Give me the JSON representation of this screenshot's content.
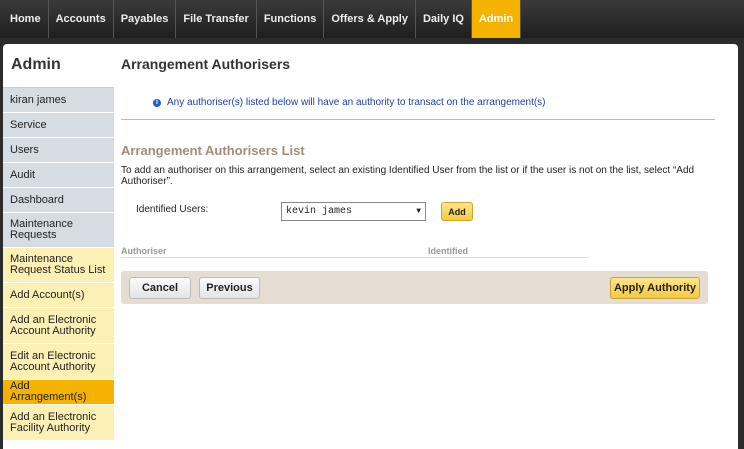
{
  "topnav": {
    "items": [
      {
        "label": "Home"
      },
      {
        "label": "Accounts"
      },
      {
        "label": "Payables"
      },
      {
        "label": "File Transfer"
      },
      {
        "label": "Functions"
      },
      {
        "label": "Offers & Apply"
      },
      {
        "label": "Daily IQ"
      },
      {
        "label": "Admin",
        "active": true
      }
    ]
  },
  "sidebar": {
    "title": "Admin",
    "items": [
      {
        "label": "kiran james"
      },
      {
        "label": "Service"
      },
      {
        "label": "Users"
      },
      {
        "label": "Audit"
      },
      {
        "label": "Dashboard"
      },
      {
        "label": "Maintenance Requests"
      },
      {
        "label": "Maintenance Request Status List"
      },
      {
        "label": "Add Account(s)"
      },
      {
        "label": "Add an Electronic Account Authority"
      },
      {
        "label": "Edit an Electronic Account Authority"
      },
      {
        "label": "Add Arrangement(s)"
      },
      {
        "label": "Add an Electronic Facility Authority"
      }
    ]
  },
  "main": {
    "title": "Arrangement Authorisers",
    "info_text": "Any authoriser(s) listed below will have an authority to transact on the arrangement(s)",
    "section_title": "Arrangement Authorisers List",
    "help_text": "To add an authoriser on this arrangement, select an existing Identified User from the list or if the user is not on the list, select “Add Authoriser”.",
    "identified_users_label": "Identified Users:",
    "identified_users_value": "kevin james",
    "add_label": "Add",
    "columns": [
      "Authoriser",
      "Identified"
    ]
  },
  "actions": {
    "cancel_label": "Cancel",
    "previous_label": "Previous",
    "apply_label": "Apply Authority"
  },
  "colors": {
    "accent": "#f5b300",
    "nav_bg": "#2b2b2b",
    "sidebar_grey": "#d5dde3",
    "sidebar_yellow": "#fdf0b5",
    "section_title": "#a08f78",
    "info_text": "#1a3fb0"
  },
  "icons": {
    "info": "info-icon",
    "dropdown": "chevron-down-icon"
  }
}
